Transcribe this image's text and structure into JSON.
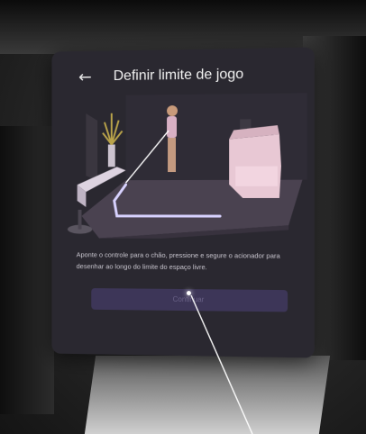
{
  "dialog": {
    "back_icon": "arrow-left-icon",
    "back_glyph": "←",
    "title": "Definir limite de jogo",
    "instructions": "Aponte o controle para o chão, pressione e segure o acionador para desenhar ao longo do limite do espaço livre.",
    "continue_label": "Continuar"
  },
  "colors": {
    "panel_bg": "#2a2830",
    "button_bg": "#3d3658",
    "boundary_line": "#d8d2ff",
    "sofa": "#e8c8d4"
  }
}
